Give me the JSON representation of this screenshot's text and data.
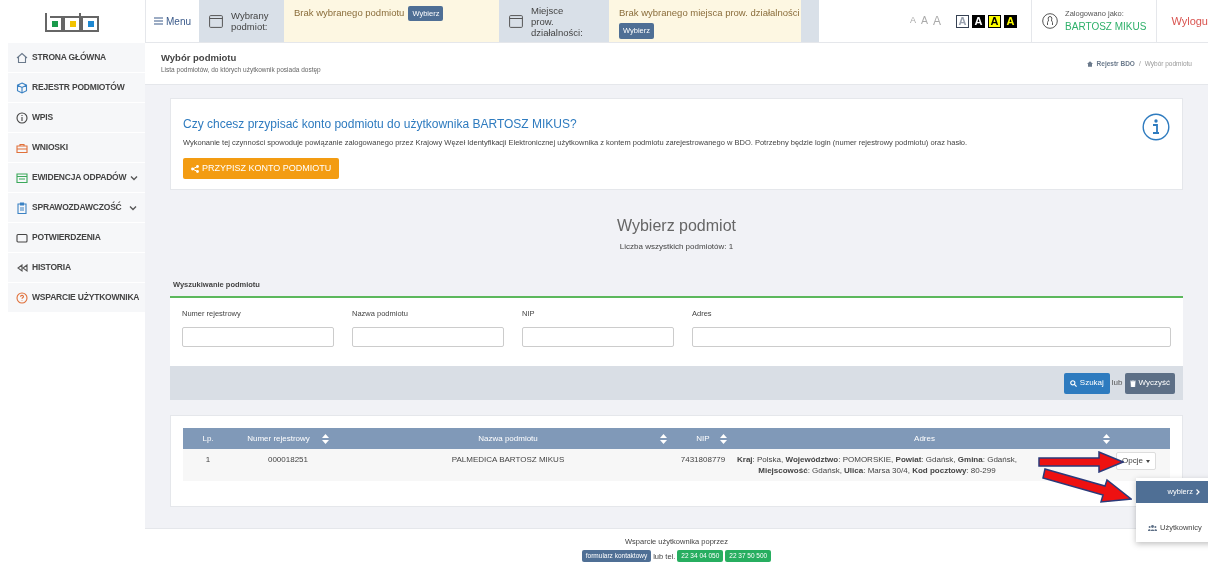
{
  "topbar": {
    "menu": "Menu",
    "entity": {
      "label": "Wybrany podmiot:",
      "value": "Brak wybranego podmiotu",
      "button": "Wybierz"
    },
    "place": {
      "label": "Miejsce prow. działalności:",
      "value": "Brak wybranego miejsca prow. działalności",
      "button": "Wybierz"
    },
    "font_sizes": [
      "A",
      "A",
      "A"
    ],
    "contrast": [
      {
        "label": "A",
        "kind": "white"
      },
      {
        "label": "A",
        "kind": "black"
      },
      {
        "label": "A",
        "kind": "yellow"
      },
      {
        "label": "A",
        "kind": "dark"
      }
    ],
    "user": {
      "label": "Zalogowano jako:",
      "name": "BARTOSZ MIKUS"
    },
    "logout": "Wylogu"
  },
  "sidebar": {
    "items": [
      {
        "label": "STRONA GŁÓWNA",
        "expandable": false
      },
      {
        "label": "REJESTR PODMIOTÓW",
        "expandable": false
      },
      {
        "label": "WPIS",
        "expandable": false
      },
      {
        "label": "WNIOSKI",
        "expandable": false
      },
      {
        "label": "EWIDENCJA ODPADÓW",
        "expandable": true
      },
      {
        "label": "SPRAWOZDAWCZOŚĆ",
        "expandable": true
      },
      {
        "label": "POTWIERDZENIA",
        "expandable": false
      },
      {
        "label": "HISTORIA",
        "expandable": false
      },
      {
        "label": "WSPARCIE UŻYTKOWNIKA",
        "expandable": false
      }
    ]
  },
  "page_header": {
    "title": "Wybór podmiotu",
    "subtitle": "Lista podmiotów, do których użytkownik posiada dostęp",
    "breadcrumb": [
      "Rejestr BDO",
      "/",
      "Wybór podmiotu"
    ]
  },
  "info": {
    "title": "Czy chcesz przypisać konto podmiotu do użytkownika BARTOSZ MIKUS?",
    "text": "Wykonanie tej czynności spowoduje powiązanie zalogowanego przez Krajowy Węzeł Identyfikacji Elektronicznej użytkownika z kontem podmiotu zarejestrowanego w BDO. Potrzebny będzie login (numer rejestrowy podmiotu) oraz hasło.",
    "button": "PRZYPISZ KONTO PODMIOTU"
  },
  "chooser": {
    "title": "Wybierz podmiot",
    "count": "Liczba wszystkich podmiotów: 1"
  },
  "search": {
    "title": "Wyszukiwanie podmiotu",
    "fields": [
      {
        "label": "Numer rejestrowy"
      },
      {
        "label": "Nazwa podmiotu"
      },
      {
        "label": "NIP"
      },
      {
        "label": "Adres"
      }
    ],
    "search_button": "Szukaj",
    "or": "lub",
    "clear_button": "Wyczyść"
  },
  "table": {
    "columns": [
      {
        "label": "Lp.",
        "sortable": false
      },
      {
        "label": "Numer rejestrowy",
        "sortable": true
      },
      {
        "label": "Nazwa podmiotu",
        "sortable": true
      },
      {
        "label": "NIP",
        "sortable": true
      },
      {
        "label": "Adres",
        "sortable": true
      }
    ],
    "rows": [
      {
        "cells": [
          "1",
          "000018251",
          "PALMEDICA BARTOSZ MIKUS",
          "7431808779",
          "**Kraj**: Polska, **Województwo**: POMORSKIE, **Powiat**: Gdańsk, **Gmina**: Gdańsk, **Miejscowość**: Gdańsk, **Ulica**: Marsa 30/4, **Kod pocztowy**: 80-299"
        ],
        "options": "Opcje"
      }
    ],
    "menu": [
      {
        "label": "wybierz",
        "selected": true
      },
      {
        "label": "Użytkownicy",
        "selected": false
      }
    ]
  },
  "footer": {
    "text": "Wsparcie użytkownika poprzez",
    "contact": "formularz kontaktowy",
    "or": "lub tel.",
    "phones": [
      "22 34 04 050",
      "22 37 50 500"
    ]
  }
}
